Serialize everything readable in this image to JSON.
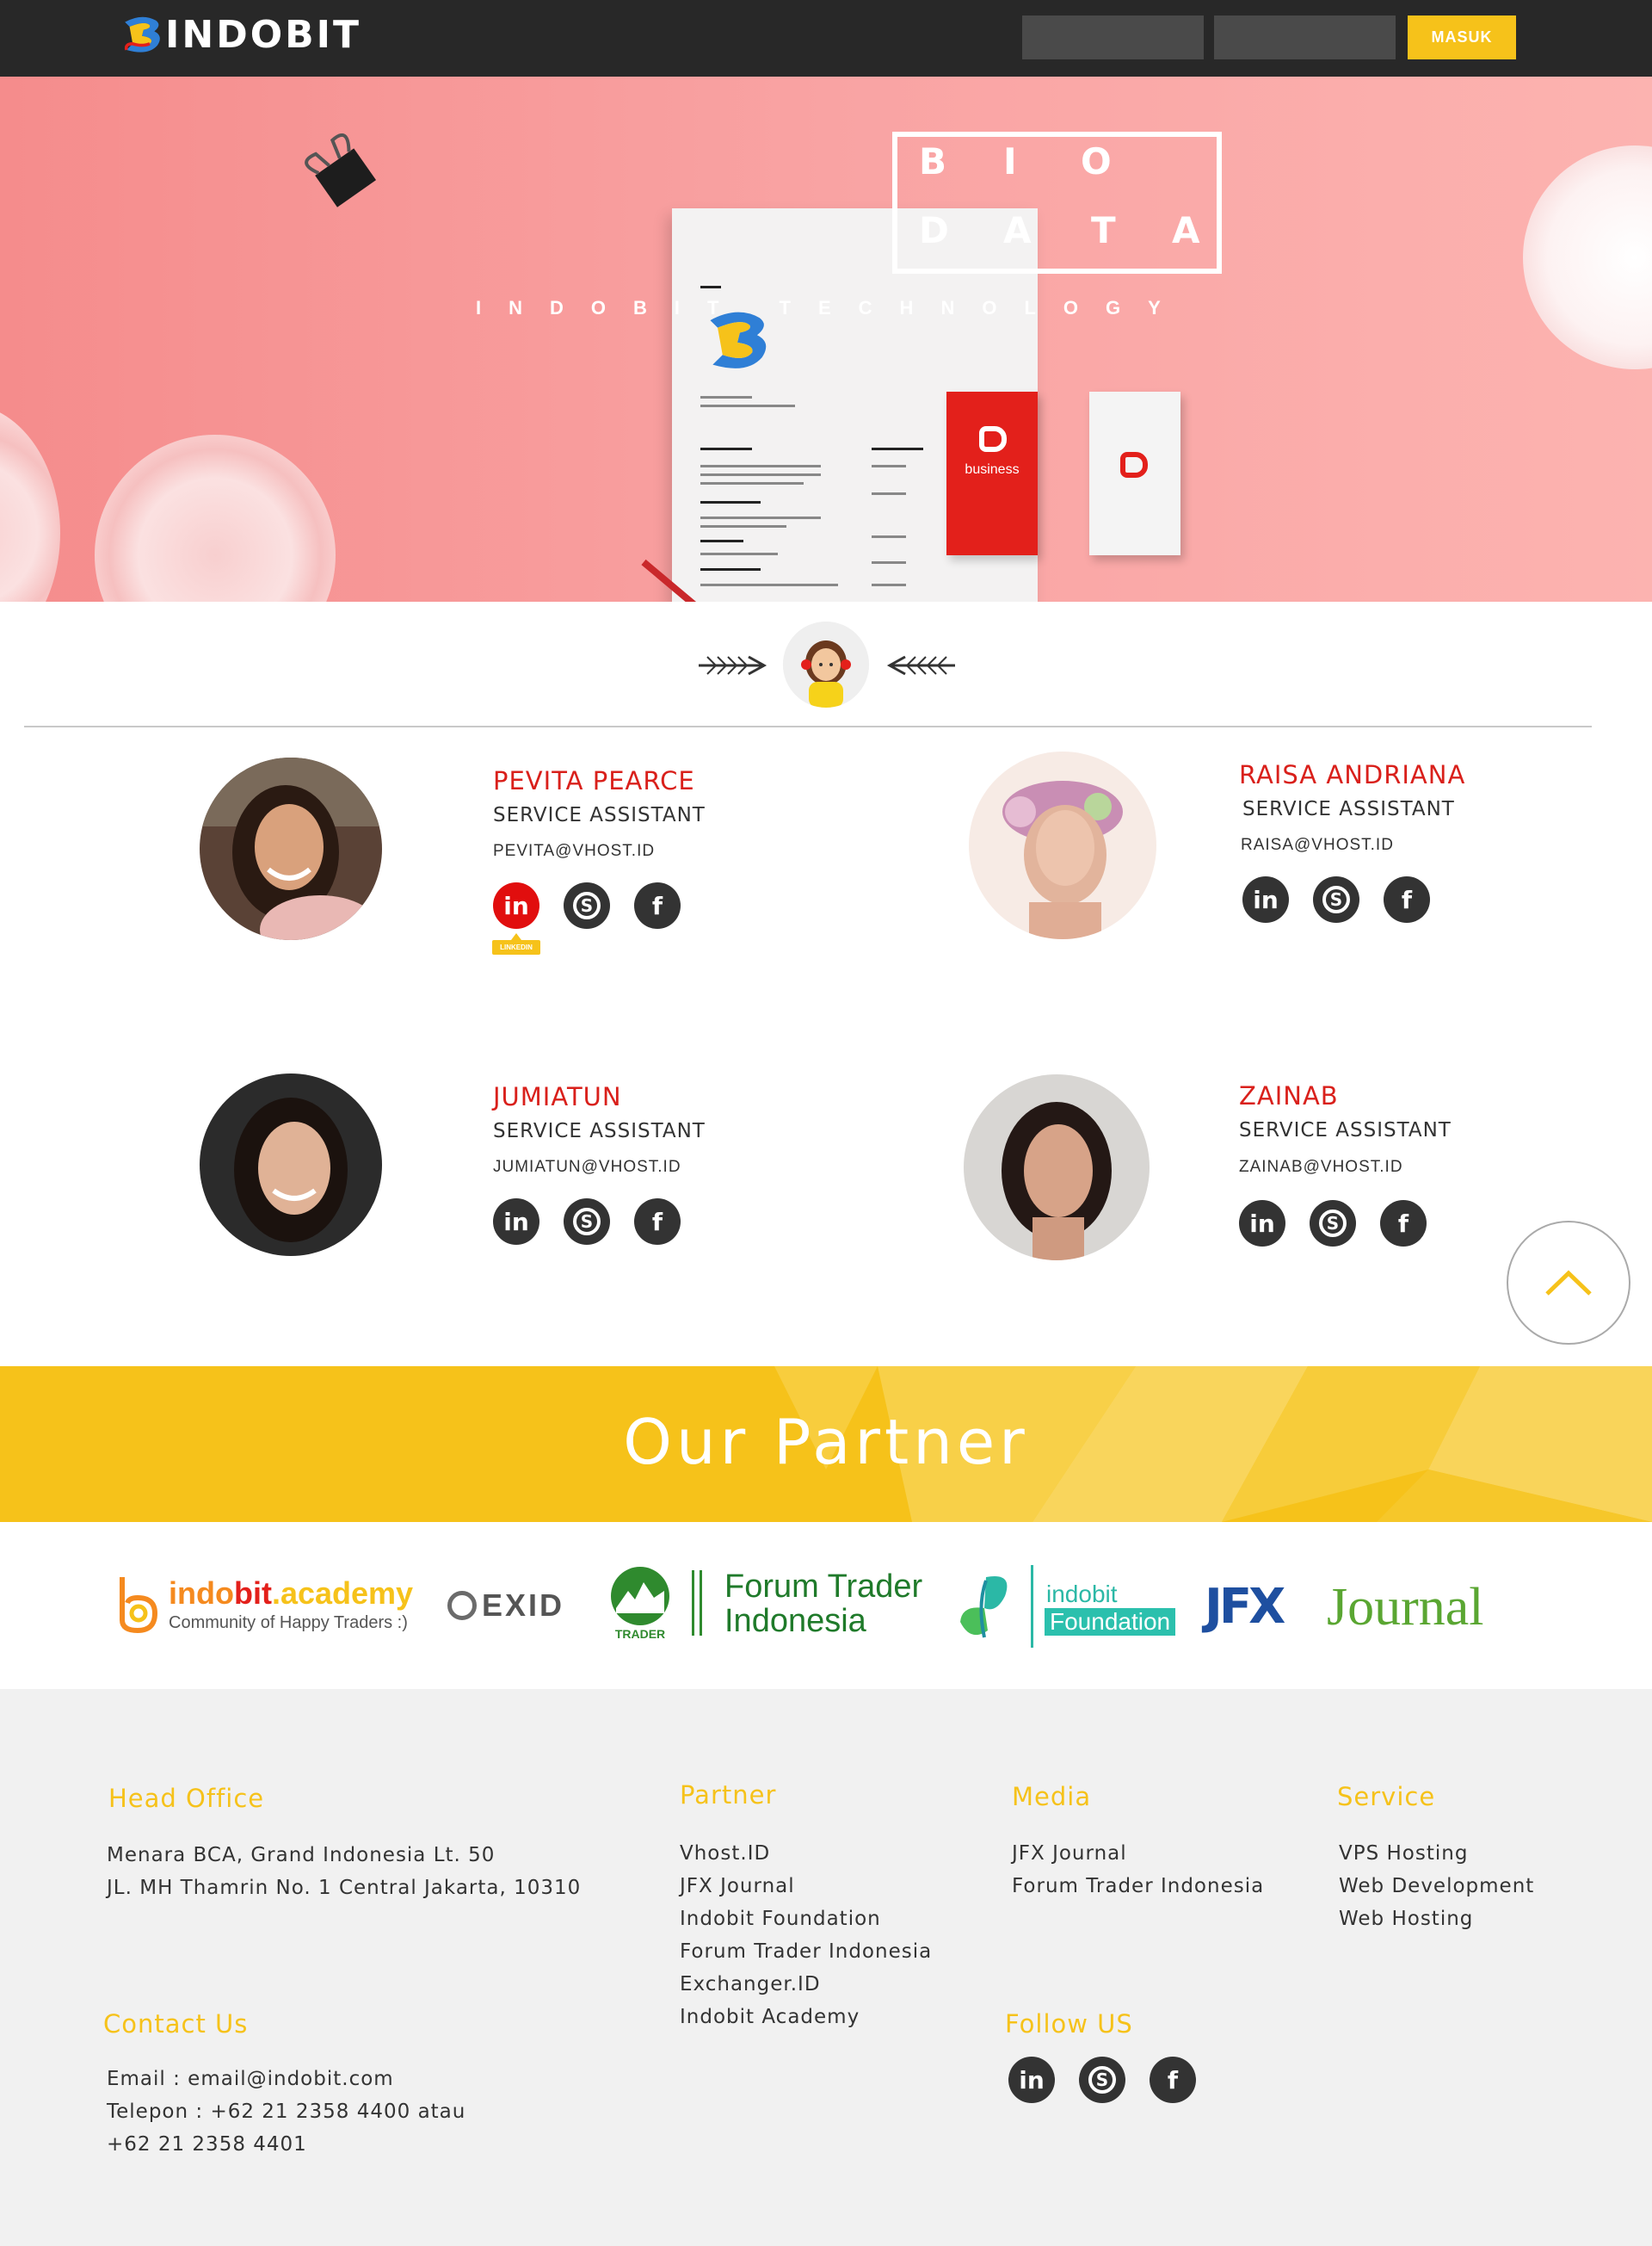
{
  "brand": {
    "name": "INDOBIT"
  },
  "nav": {
    "username_placeholder": "",
    "password_placeholder": "",
    "login_label": "MASUK"
  },
  "hero": {
    "bio_top": [
      "B",
      "I",
      "O"
    ],
    "bio_bottom": [
      "D",
      "A",
      "T",
      "A"
    ],
    "tagline": "INDOBIT TECHNOLOGY",
    "card_label": "business"
  },
  "team": {
    "members": [
      {
        "name": "PEVITA PEARCE",
        "role": "SERVICE ASSISTANT",
        "email": "PEVITA@VHOST.ID"
      },
      {
        "name": "RAISA ANDRIANA",
        "role": "SERVICE ASSISTANT",
        "email": "RAISA@VHOST.ID"
      },
      {
        "name": "JUMIATUN",
        "role": "SERVICE ASSISTANT",
        "email": "JUMIATUN@VHOST.ID"
      },
      {
        "name": "ZAINAB",
        "role": "SERVICE ASSISTANT",
        "email": "ZAINAB@VHOST.ID"
      }
    ],
    "tooltip": "LINKEDIN"
  },
  "partners": {
    "title": "Our Partner",
    "logos": {
      "academy_name_part1": "indo",
      "academy_name_part2": "bit",
      "academy_name_part3": ".academy",
      "academy_tagline": "Community of Happy Traders :)",
      "exid": "EXID",
      "fti_line1": "Forum Trader",
      "fti_line2": "Indonesia",
      "fti_badge": "TRADER",
      "foundation_line1": "indobit",
      "foundation_line2": "Foundation",
      "jfx_part1": "JFX",
      "jfx_part2": "Journal"
    }
  },
  "footer": {
    "head_office": {
      "title": "Head Office",
      "lines": [
        "Menara BCA, Grand Indonesia Lt. 50",
        "JL. MH Thamrin No. 1 Central Jakarta, 10310"
      ]
    },
    "contact": {
      "title": "Contact Us",
      "lines": [
        "Email : email@indobit.com",
        "Telepon : +62 21 2358 4400 atau",
        "+62 21 2358 4401"
      ]
    },
    "partner": {
      "title": "Partner",
      "items": [
        "Vhost.ID",
        "JFX Journal",
        "Indobit Foundation",
        "Forum Trader Indonesia",
        "Exchanger.ID",
        "Indobit Academy"
      ]
    },
    "media": {
      "title": "Media",
      "items": [
        "JFX Journal",
        "Forum Trader Indonesia"
      ]
    },
    "service": {
      "title": "Service",
      "items": [
        "VPS Hosting",
        "Web Development",
        "Web Hosting"
      ]
    },
    "follow": {
      "title": "Follow US"
    }
  },
  "icons": {
    "linkedin": "linkedin-icon",
    "skype": "skype-icon",
    "facebook": "facebook-icon"
  },
  "colors": {
    "topbar": "#282828",
    "accent_yellow": "#f6c21a",
    "name_red": "#d9201b",
    "hero_pink": "#f9a3a3"
  }
}
